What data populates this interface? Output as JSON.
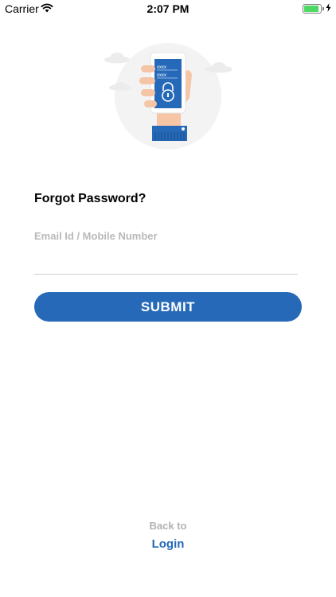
{
  "status_bar": {
    "carrier": "Carrier",
    "time": "2:07 PM",
    "battery_level": 1.0,
    "wifi_icon": "wifi-icon",
    "charging_icon": "charging-bolt-icon"
  },
  "illustration": {
    "icon": "phone-lock-illustration",
    "screen_lines": [
      "xxxx",
      "xxxx"
    ]
  },
  "form": {
    "title": "Forgot Password?",
    "email_placeholder": "Email Id / Mobile Number",
    "email_value": "",
    "submit_label": "SUBMIT"
  },
  "footer": {
    "back_to": "Back to",
    "login_label": "Login"
  },
  "colors": {
    "primary": "#2569b8",
    "placeholder": "#b9b9b9",
    "muted_text": "#b2b2b2",
    "divider": "#cfcfcf",
    "battery": "#4cd964"
  }
}
